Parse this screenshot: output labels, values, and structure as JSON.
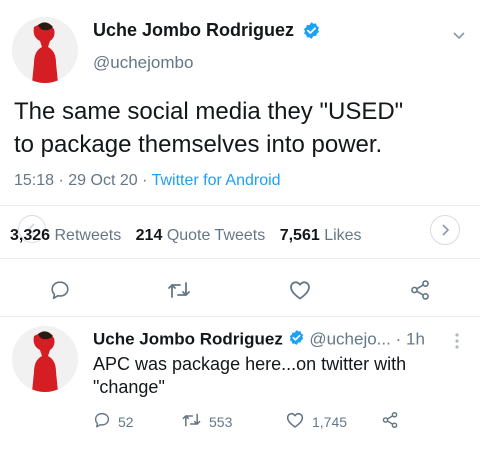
{
  "tweet": {
    "author_name": "Uche Jombo Rodriguez",
    "handle": "@uchejombo",
    "text_line1": "The same social media they \"USED\"",
    "text_line2": "to package themselves into power.",
    "time": "15:18",
    "date": "29 Oct 20",
    "sep": "·",
    "source": "Twitter for Android",
    "retweets_count": "3,326",
    "retweets_label": "Retweets",
    "quotes_count": "214",
    "quotes_label": "Quote Tweets",
    "likes_count": "7,561",
    "likes_label": "Likes"
  },
  "reply": {
    "author_name": "Uche Jombo Rodriguez",
    "handle": "@uchejo...",
    "age": "1h",
    "sep": "·",
    "text_line1": "APC was package here...on twitter with",
    "text_line2": "\"change\"",
    "reply_count": "52",
    "retweet_count": "553",
    "like_count": "1,745"
  },
  "icons": {
    "verified": "verified-badge-icon",
    "caret": "chevron-down-icon",
    "reply": "reply-icon",
    "retweet": "retweet-icon",
    "like": "heart-icon",
    "share": "share-icon"
  },
  "colors": {
    "accent": "#1da1f2",
    "muted": "#657786",
    "text": "#14171a"
  }
}
